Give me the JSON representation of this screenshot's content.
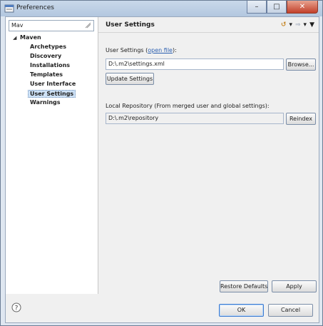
{
  "window": {
    "title": "Preferences"
  },
  "filter": {
    "value": "Mav"
  },
  "tree": {
    "root": "Maven",
    "items": [
      "Archetypes",
      "Discovery",
      "Installations",
      "Templates",
      "User Interface",
      "User Settings",
      "Warnings"
    ],
    "selected": "User Settings"
  },
  "page": {
    "title": "User Settings",
    "user_settings_label": "User Settings (",
    "open_file_link": "open file",
    "user_settings_label_end": "):",
    "user_settings_value": "D:\\.m2\\settings.xml",
    "browse_button": "Browse...",
    "update_button": "Update Settings",
    "local_repo_label": "Local Repository (From merged user and global settings):",
    "local_repo_value": "D:\\.m2\\repository",
    "reindex_button": "Reindex"
  },
  "buttons": {
    "restore_defaults": "Restore Defaults",
    "apply": "Apply",
    "ok": "OK",
    "cancel": "Cancel"
  },
  "icons": {
    "app": "preferences-icon",
    "help": "help-icon"
  }
}
